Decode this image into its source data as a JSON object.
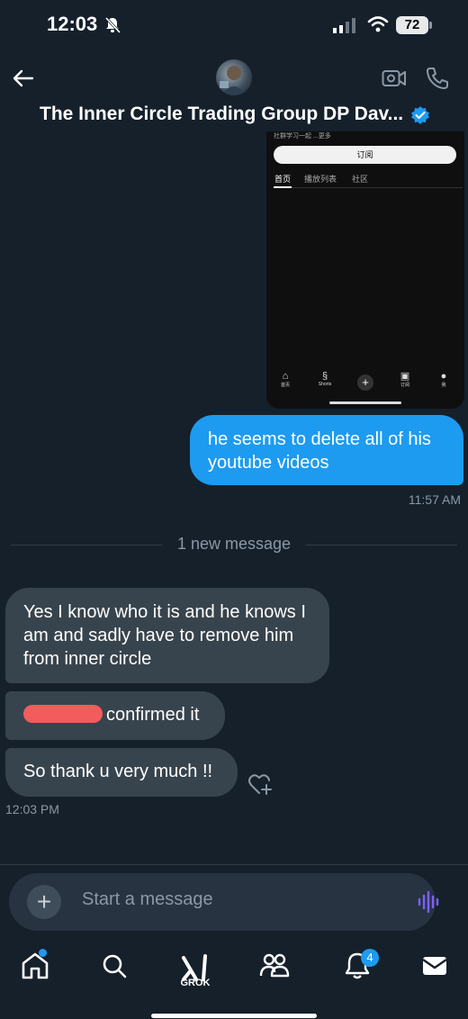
{
  "status_bar": {
    "time": "12:03",
    "battery": "72"
  },
  "header": {
    "title": "The Inner Circle Trading Group DP Dav..."
  },
  "shared_image": {
    "description": "社群学习一起 ...更多",
    "subscribe_label": "订阅",
    "tabs": [
      "首页",
      "播放列表",
      "社区"
    ],
    "nav": [
      "首页",
      "Shorts",
      "订阅",
      "我"
    ]
  },
  "messages": {
    "outgoing": {
      "text": "he seems to delete all of his youtube videos",
      "time": "11:57 AM"
    },
    "divider": "1 new message",
    "incoming": [
      {
        "text": "Yes I know who it is and he knows I am and sadly have to remove him from inner circle"
      },
      {
        "text": "confirmed it"
      },
      {
        "text": "So thank u very much !!"
      }
    ],
    "incoming_time": "12:03 PM"
  },
  "composer": {
    "placeholder": "Start a message"
  },
  "tab_bar": {
    "grok_label": "GROK",
    "notification_count": "4"
  },
  "colors": {
    "background": "#15202b",
    "accent": "#1d9bf0",
    "bubble_in": "#38444d"
  }
}
